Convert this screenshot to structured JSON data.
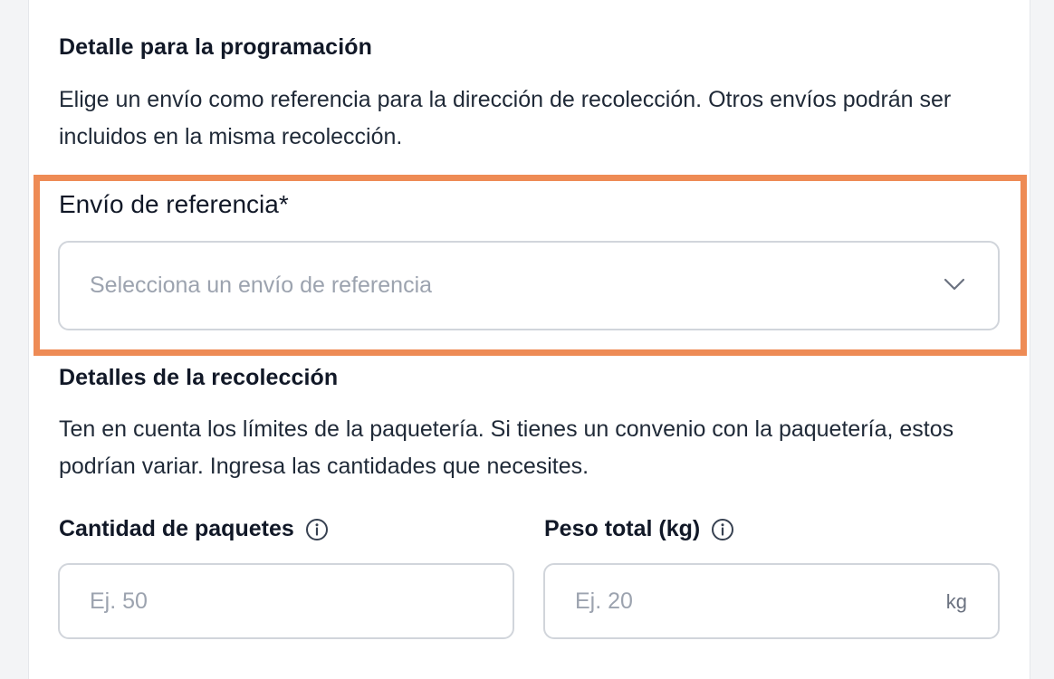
{
  "schedule_section": {
    "title": "Detalle para la programación",
    "description": "Elige un envío como referencia para la dirección de recolección. Otros envíos podrán ser incluidos en la misma recolección."
  },
  "reference_shipment": {
    "label": "Envío de referencia*",
    "placeholder": "Selecciona un envío de referencia",
    "icon": "chevron-down-icon"
  },
  "pickup_section": {
    "title": "Detalles de la recolección",
    "description": "Ten en cuenta los límites de la paquetería. Si tienes un convenio con la paquetería, estos podrían variar. Ingresa las cantidades que necesites."
  },
  "package_count": {
    "label": "Cantidad de paquetes",
    "placeholder": "Ej. 50",
    "icon": "info-icon"
  },
  "total_weight": {
    "label": "Peso total (kg)",
    "placeholder": "Ej. 20",
    "unit": "kg",
    "icon": "info-icon"
  },
  "colors": {
    "highlight": "#ee8b55",
    "border": "#d1d5db",
    "placeholder": "#9ca3af",
    "text": "#111827"
  }
}
